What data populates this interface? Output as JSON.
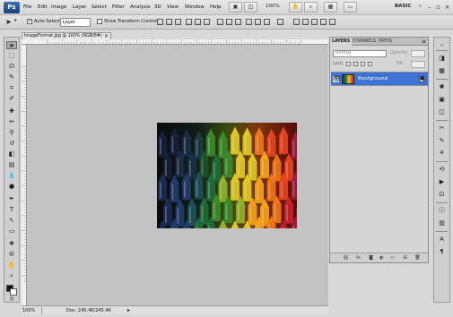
{
  "app": {
    "logo_text": "Ps"
  },
  "menubar": {
    "items": [
      "File",
      "Edit",
      "Image",
      "Layer",
      "Select",
      "Filter",
      "Analysis",
      "3D",
      "View",
      "Window",
      "Help"
    ],
    "zoom": "100%",
    "workspace": "BASIC"
  },
  "options": {
    "auto_select_label": "Auto-Select:",
    "auto_select_value": "Layer",
    "show_transform_label": "Show Transform Controls"
  },
  "document": {
    "tab_title": "ImageFormat.jpg @ 100% (RGB/8#)",
    "zoom": "100%",
    "doc_info": "Doc: 245.4K/245.4K"
  },
  "layers_panel": {
    "tabs": [
      "LAYERS",
      "CHANNELS",
      "PATHS"
    ],
    "active_tab": "LAYERS",
    "blend_mode": "Normal",
    "opacity_label": "Opacity:",
    "lock_label": "Lock:",
    "fill_label": "Fill:",
    "layers": [
      {
        "name": "Background",
        "visible": true,
        "locked": true,
        "selected": true
      }
    ]
  },
  "colors": {
    "selection_blue": "#3d72d6",
    "canvas_gray": "#c3c3c3",
    "chrome_gray": "#d6d6d6"
  }
}
